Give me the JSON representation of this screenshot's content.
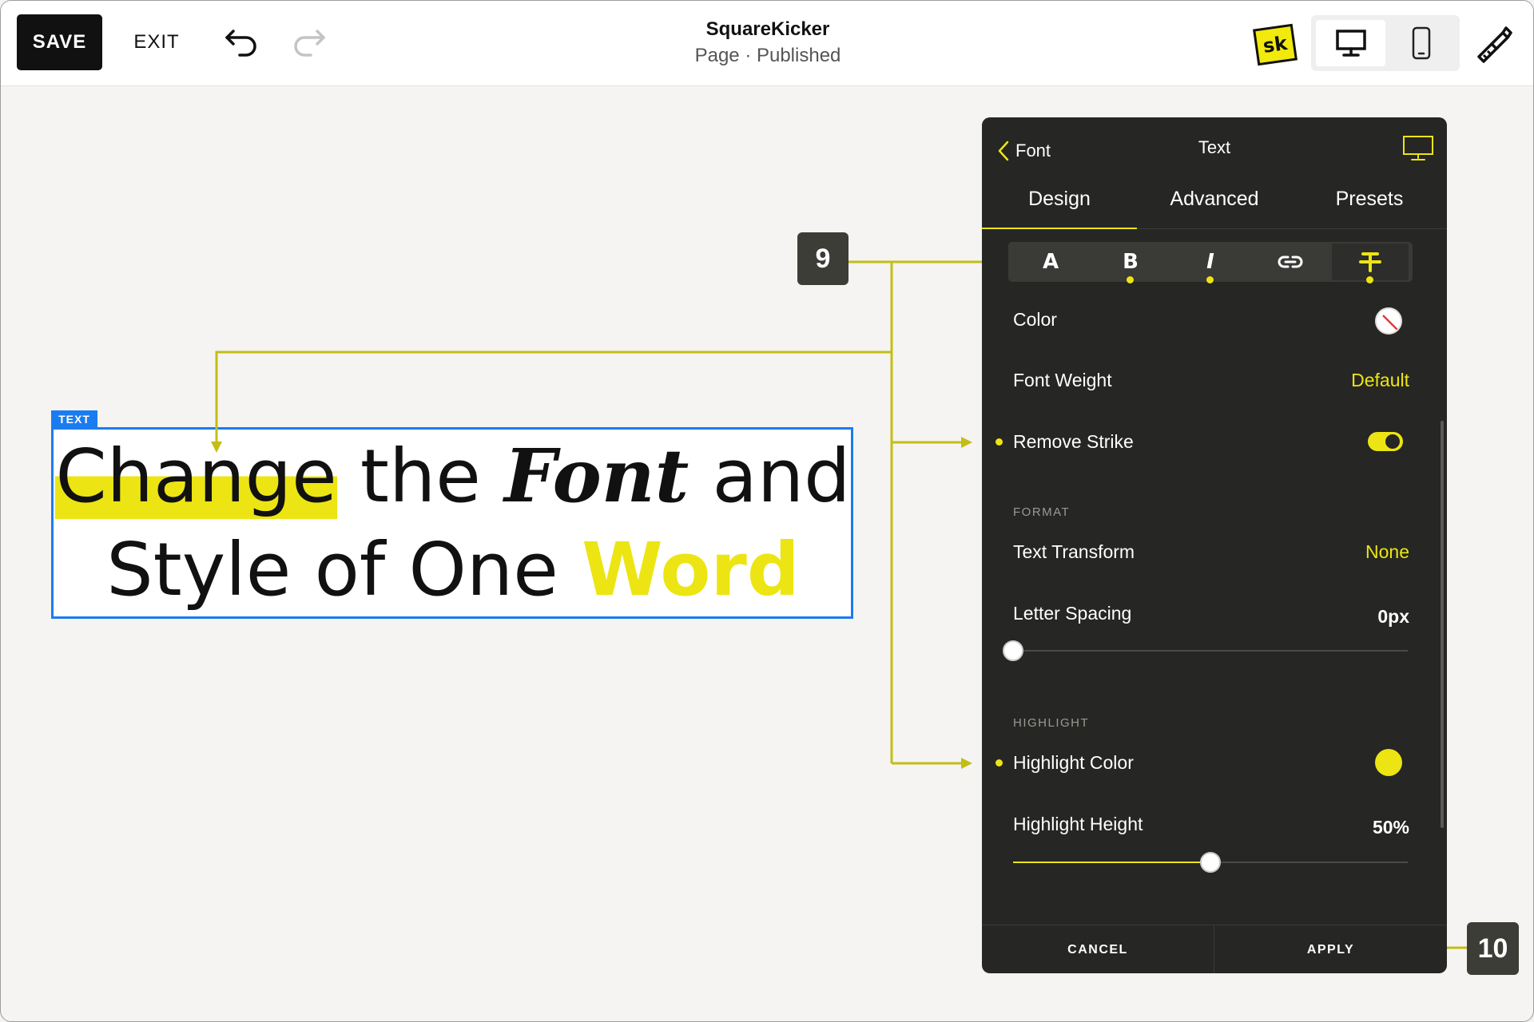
{
  "toolbar": {
    "save_label": "SAVE",
    "exit_label": "EXIT",
    "site_title": "SquareKicker",
    "page_status": "Page · Published",
    "logo_text": "sk"
  },
  "canvas": {
    "block_tag": "TEXT",
    "heading": {
      "w_change": "Change",
      "w_the": "the",
      "w_font": "Font",
      "w_and": "and",
      "w_style": "Style of One",
      "w_word": "Word"
    }
  },
  "annotations": {
    "step_a": "9",
    "step_b": "10"
  },
  "panel": {
    "back_label": "Font",
    "title": "Text",
    "tabs": [
      "Design",
      "Advanced",
      "Presets"
    ],
    "style_buttons": [
      "A",
      "B",
      "I"
    ],
    "rows": {
      "color_label": "Color",
      "font_weight_label": "Font Weight",
      "font_weight_value": "Default",
      "remove_strike_label": "Remove Strike",
      "format_section": "FORMAT",
      "text_transform_label": "Text Transform",
      "text_transform_value": "None",
      "letter_spacing_label": "Letter Spacing",
      "letter_spacing_value": "0px",
      "highlight_section": "HIGHLIGHT",
      "highlight_color_label": "Highlight Color",
      "highlight_height_label": "Highlight Height",
      "highlight_height_value": "50%"
    },
    "remove_strike_on": true,
    "highlight_height_fraction": 0.5,
    "letter_spacing_fraction": 0.0,
    "cancel_label": "CANCEL",
    "apply_label": "APPLY"
  },
  "colors": {
    "accent_yellow": "#ece513",
    "panel_bg": "#262624",
    "selection_blue": "#1b7cf0"
  },
  "icons": [
    "undo-icon",
    "redo-icon",
    "desktop-icon",
    "mobile-icon",
    "paintbrush-icon",
    "chevron-left-icon",
    "link-icon",
    "strikethrough-icon"
  ]
}
